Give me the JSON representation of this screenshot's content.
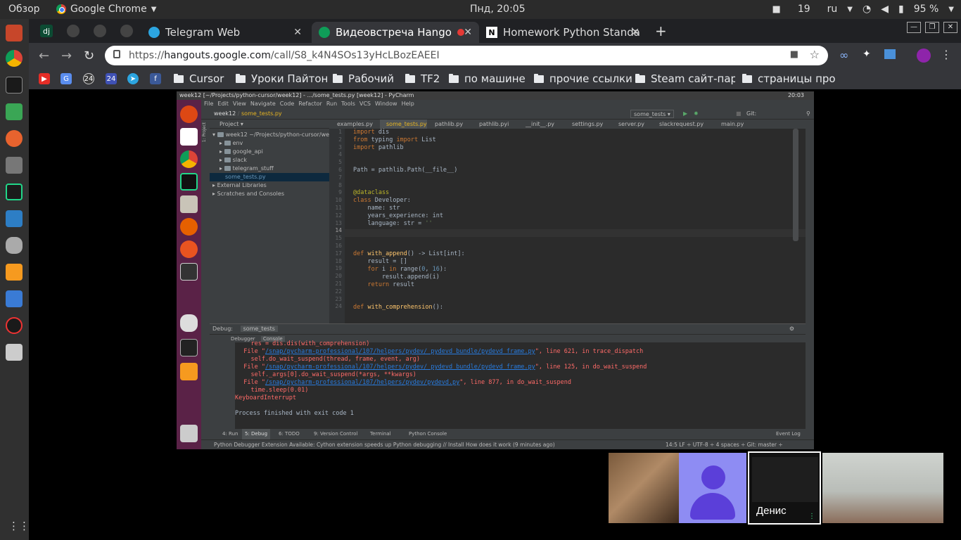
{
  "system_bar": {
    "activities": "Обзор",
    "app_name": "Google Chrome",
    "clock": "Пнд, 20:05",
    "badge_count": "19",
    "keyboard_layout": "ru",
    "battery": "95 %"
  },
  "tabs": [
    {
      "label": "Telegram Web"
    },
    {
      "label": "Видеовстреча Hango"
    },
    {
      "label": "Homework Python Standa"
    }
  ],
  "pinned_tabs": [
    "dj"
  ],
  "omnibox": {
    "scheme": "https://",
    "host": "hangouts.google.com",
    "path": "/call/S8_k4N4SOs13yHcLBozEAEEI"
  },
  "bookmarks": [
    {
      "label": "Cursor"
    },
    {
      "label": "Уроки Пайтон"
    },
    {
      "label": "Рабочий"
    },
    {
      "label": "TF2"
    },
    {
      "label": "по машине"
    },
    {
      "label": "прочие ссылки"
    },
    {
      "label": "Steam сайт-парс"
    },
    {
      "label": "страницы проек"
    }
  ],
  "bookmark_icons": [
    "24",
    "24"
  ],
  "remote": {
    "topbar_title": "week12 [~/Projects/python-cursor/week12] - .../some_tests.py [week12] - PyCharm",
    "topbar_time": "20:03",
    "menu": [
      "File",
      "Edit",
      "View",
      "Navigate",
      "Code",
      "Refactor",
      "Run",
      "Tools",
      "VCS",
      "Window",
      "Help"
    ],
    "breadcrumb_project": "week12",
    "breadcrumb_file": "some_tests.py",
    "run_config": "some_tests",
    "git_label": "Git:",
    "project_label": "Project",
    "side_project_label": "1: Project",
    "tree": [
      {
        "label": "week12  ~/Projects/python-cursor/wee",
        "indent": 0
      },
      {
        "label": "env",
        "indent": 1
      },
      {
        "label": "google_api",
        "indent": 1
      },
      {
        "label": "slack",
        "indent": 1
      },
      {
        "label": "telegram_stuff",
        "indent": 1
      },
      {
        "label": "some_tests.py",
        "indent": 1
      },
      {
        "label": "External Libraries",
        "indent": 0
      },
      {
        "label": "Scratches and Consoles",
        "indent": 0
      }
    ],
    "editor_tabs": [
      "examples.py",
      "some_tests.py",
      "pathlib.py",
      "pathlib.pyi",
      "__init__.py",
      "settings.py",
      "server.py",
      "slackrequest.py",
      "main.py"
    ],
    "line_numbers": [
      "1",
      "2",
      "3",
      "4",
      "5",
      "6",
      "7",
      "8",
      "9",
      "10",
      "11",
      "12",
      "13",
      "14",
      "15",
      "16",
      "17",
      "18",
      "19",
      "20",
      "21",
      "22",
      "23",
      "24"
    ],
    "code": {
      "l1_kw": "import",
      "l1_rest": " dis",
      "l2_kw1": "from",
      "l2_mid": " typing ",
      "l2_kw2": "import",
      "l2_rest": " List",
      "l3_kw": "import",
      "l3_rest": " pathlib",
      "l6": "Path = pathlib.Path(__file__)",
      "l9": "@dataclass",
      "l10_kw": "class",
      "l10_rest": " Developer:",
      "l11": "    name: str",
      "l12": "    years_experience: int",
      "l13_a": "    language: str = ",
      "l13_str": "''",
      "l17_kw": "def",
      "l17_fn": " with_append",
      "l17_rest": "() -> List[int]:",
      "l18": "    result = []",
      "l19_kw": "    for",
      "l19_mid": " i ",
      "l19_kw2": "in",
      "l19_rest": " range(",
      "l19_n1": "0",
      "l19_sep": ", ",
      "l19_n2": "16",
      "l19_end": "):",
      "l20": "        result.append(i)",
      "l21_kw": "    return",
      "l21_rest": " result",
      "l24_kw": "def",
      "l24_fn": " with_comprehension",
      "l24_rest": "():"
    },
    "debug_label": "Debug:",
    "debug_config": "some_tests",
    "debugger_tab": "Debugger",
    "console_tab": "Console",
    "console": {
      "c1": "    res = dis.dis(with_comprehension)",
      "c2_a": "  File \"",
      "c2_link": "/snap/pycharm-professional/107/helpers/pydev/_pydevd_bundle/pydevd_frame.py",
      "c2_b": "\", line 621, in trace_dispatch",
      "c3": "    self.do_wait_suspend(thread, frame, event, arg)",
      "c4_a": "  File \"",
      "c4_link": "/snap/pycharm-professional/107/helpers/pydev/_pydevd_bundle/pydevd_frame.py",
      "c4_b": "\", line 125, in do_wait_suspend",
      "c5": "    self._args[0].do_wait_suspend(*args, **kwargs)",
      "c6_a": "  File \"",
      "c6_link": "/snap/pycharm-professional/107/helpers/pydev/pydevd.py",
      "c6_b": "\", line 877, in do_wait_suspend",
      "c7": "    time.sleep(0.01)",
      "c8": "KeyboardInterrupt",
      "c9": "Process finished with exit code 1"
    },
    "bottom_tabs": [
      "4: Run",
      "5: Debug",
      "6: TODO",
      "9: Version Control",
      "Terminal",
      "Python Console",
      "Event Log"
    ],
    "status_text": "Python Debugger Extension Available: Cython extension speeds up Python debugging // Install How does it work (9 minutes ago)",
    "status_right": "14:5   LF ÷   UTF-8 ÷   4 spaces ÷   Git: master ÷"
  },
  "participants": [
    {
      "name": ""
    },
    {
      "name": ""
    },
    {
      "name": "Денис"
    },
    {
      "name": ""
    }
  ],
  "colors": {
    "chrome_dark": "#202124",
    "chrome_toolbar": "#35363a",
    "ubuntu_dock_remote": "#5a2247",
    "avatar": "#5b3fd9",
    "error_text": "#ff6b68"
  }
}
